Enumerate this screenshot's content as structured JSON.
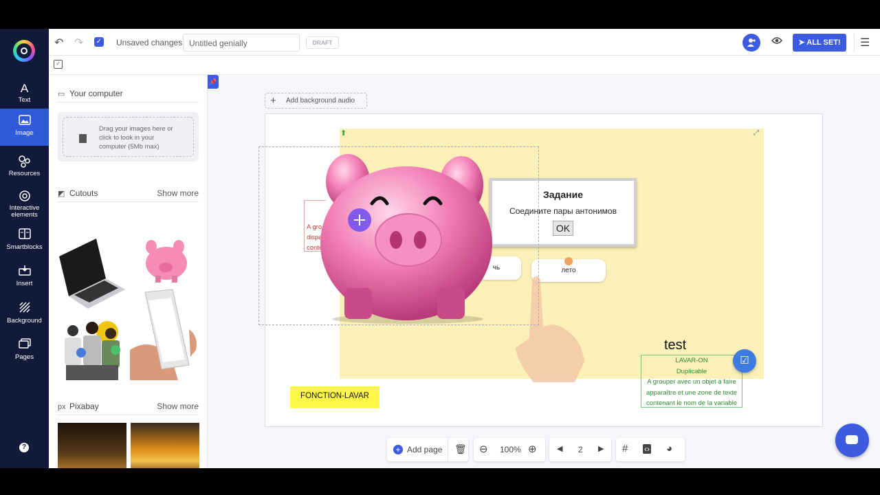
{
  "rail": {
    "items": [
      {
        "label": "Text",
        "icon": "text-icon"
      },
      {
        "label": "Image",
        "icon": "image-icon",
        "active": true
      },
      {
        "label": "Resources",
        "icon": "resources-icon"
      },
      {
        "label": "Interactive elements",
        "icon": "interactive-icon"
      },
      {
        "label": "Smartblocks",
        "icon": "smartblocks-icon"
      },
      {
        "label": "Insert",
        "icon": "insert-icon"
      },
      {
        "label": "Background",
        "icon": "background-icon"
      },
      {
        "label": "Pages",
        "icon": "pages-icon"
      }
    ],
    "help": "?"
  },
  "topbar": {
    "unsaved": "Unsaved changes",
    "title_value": "Untitled genially",
    "draft": "DRAFT",
    "all_set": "ALL SET!"
  },
  "panel": {
    "computer_title": "Your computer",
    "upload_text": "Drag your images here or click to look in your computer (5Mb max)",
    "cutouts_title": "Cutouts",
    "cutouts_more": "Show more",
    "pixabay_title": "Pixabay",
    "pixabay_more": "Show more"
  },
  "canvas": {
    "bg_audio": "Add background audio",
    "dialog_title": "Задание",
    "dialog_text": "Соедините пары антонимов",
    "dialog_ok": "OK",
    "card_left": "чь",
    "card_right": "лето",
    "test": "test",
    "green_lines": [
      "LAVAR-ON",
      "Duplicable",
      "A grouper avec un objet à faire",
      "apparaître et une zone de texte",
      "contenant le nom de la variable"
    ],
    "fonction": "FONCTION-LAVAR",
    "red_lines": [
      "A gro",
      "dispa",
      "conte"
    ]
  },
  "bottom": {
    "add_page": "Add page",
    "zoom": "100%",
    "page": "2"
  },
  "colors": {
    "rail_bg": "#121a3a",
    "accent": "#3d5be0",
    "yellow_bg": "#fbf1b8",
    "fonction_bg": "#fff64a"
  }
}
